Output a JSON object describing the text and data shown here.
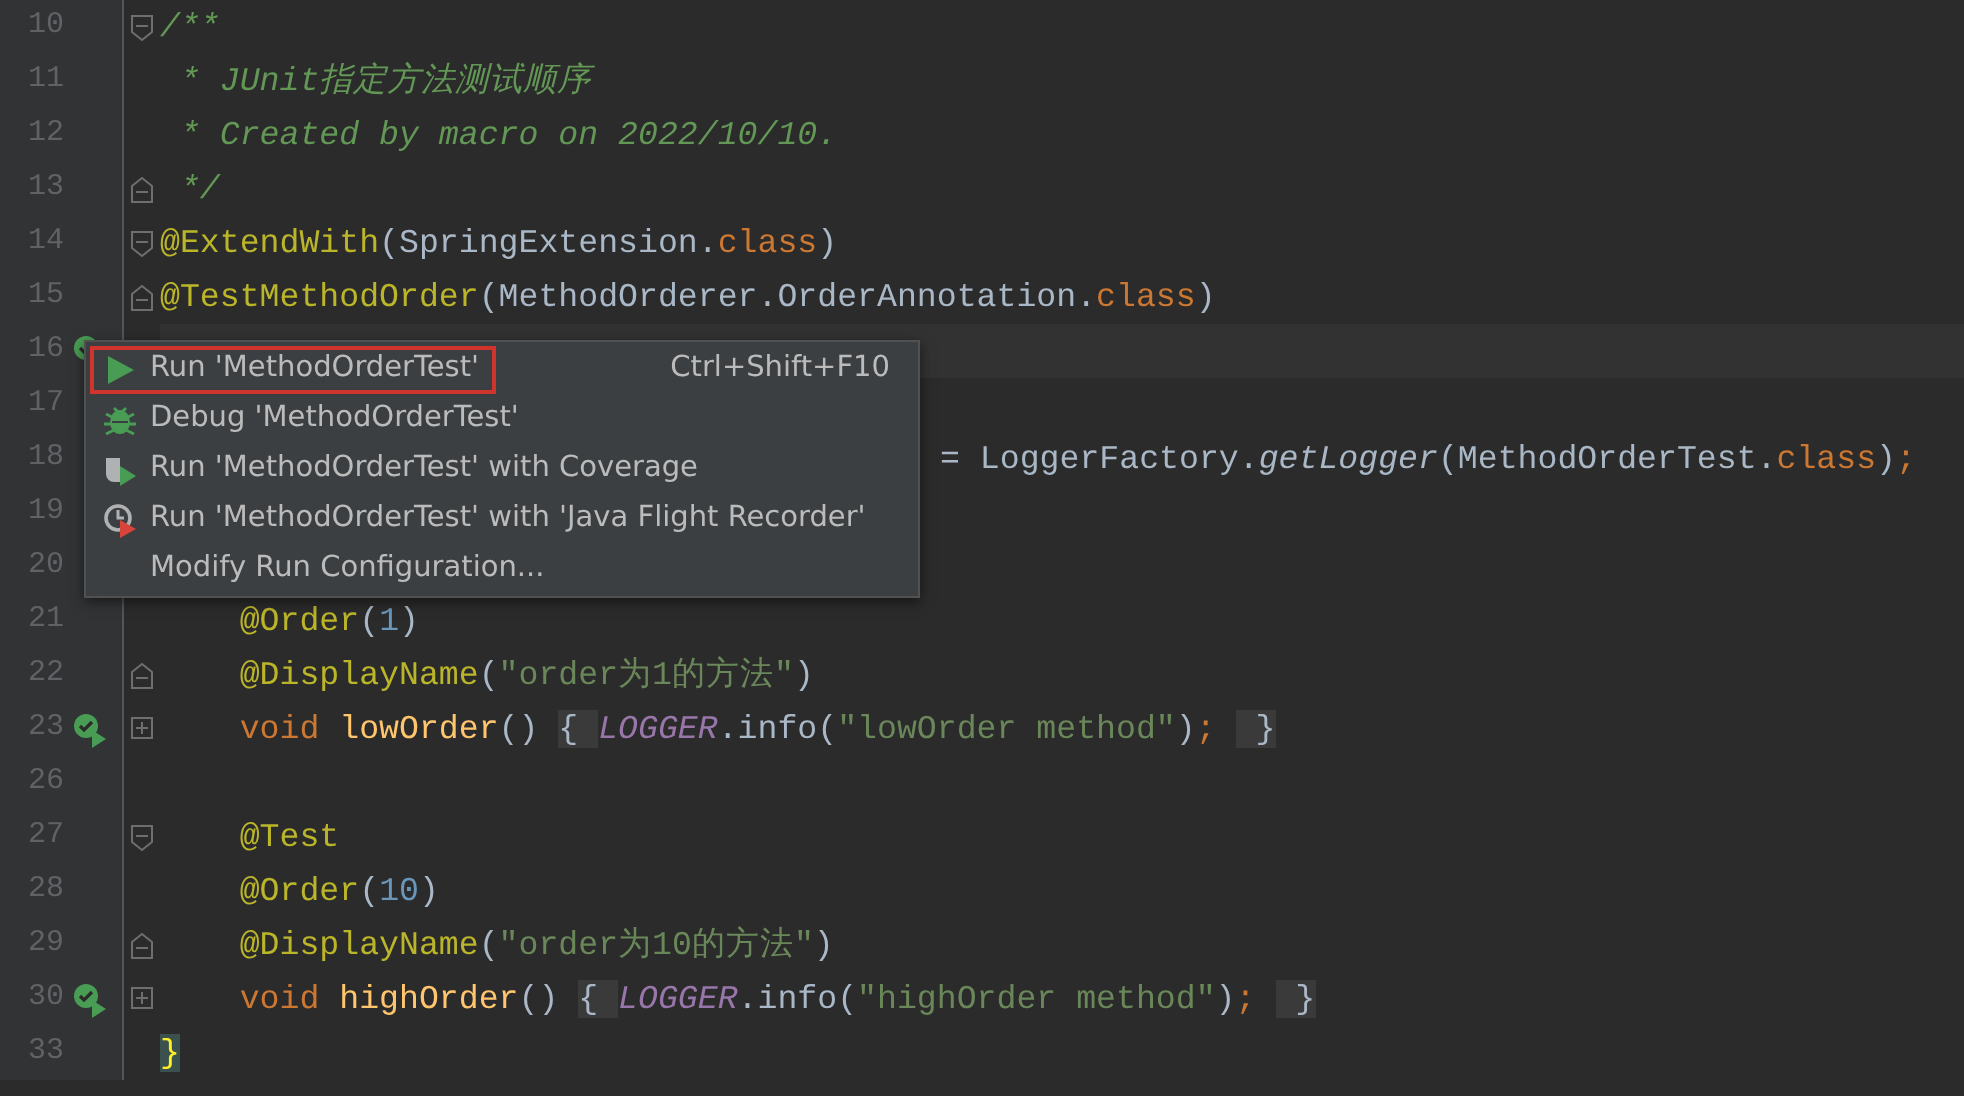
{
  "editor": {
    "lines": [
      {
        "number": "10",
        "fold_start": true,
        "tokens": [
          {
            "kind": "comment",
            "text": "/**"
          }
        ]
      },
      {
        "number": "11",
        "tokens": [
          {
            "kind": "comment",
            "text": " * JUnit指定方法测试顺序"
          }
        ]
      },
      {
        "number": "12",
        "tokens": [
          {
            "kind": "comment",
            "text": " * Created by macro on 2022/10/10."
          }
        ]
      },
      {
        "number": "13",
        "fold_end": true,
        "tokens": [
          {
            "kind": "comment",
            "text": " */"
          }
        ]
      },
      {
        "number": "14",
        "fold_start": true,
        "tokens": [
          {
            "kind": "annotation",
            "text": "@ExtendWith"
          },
          {
            "kind": "plain",
            "text": "(SpringExtension."
          },
          {
            "kind": "keyword",
            "text": "class"
          },
          {
            "kind": "plain",
            "text": ")"
          }
        ]
      },
      {
        "number": "15",
        "fold_end": true,
        "tokens": [
          {
            "kind": "annotation",
            "text": "@TestMethodOrder"
          },
          {
            "kind": "plain",
            "text": "(MethodOrderer.OrderAnnotation."
          },
          {
            "kind": "keyword",
            "text": "class"
          },
          {
            "kind": "plain",
            "text": ")"
          }
        ]
      },
      {
        "number": "16",
        "runnable": true,
        "current": true
      },
      {
        "number": "17"
      },
      {
        "number": "18",
        "starts_under_popup": true,
        "tokens": [
          {
            "kind": "plain",
            "text": "= LoggerFactory."
          },
          {
            "kind": "call",
            "text": "getLogger"
          },
          {
            "kind": "plain",
            "text": "(MethodOrderTest."
          },
          {
            "kind": "keyword",
            "text": "class"
          },
          {
            "kind": "plain",
            "text": ")"
          },
          {
            "kind": "keyword",
            "text": ";"
          }
        ]
      },
      {
        "number": "19"
      },
      {
        "number": "20"
      },
      {
        "number": "21",
        "tokens": [
          {
            "kind": "annotation",
            "text": "    @Order"
          },
          {
            "kind": "plain",
            "text": "("
          },
          {
            "kind": "number",
            "text": "1"
          },
          {
            "kind": "plain",
            "text": ")"
          }
        ]
      },
      {
        "number": "22",
        "fold_end": true,
        "tokens": [
          {
            "kind": "annotation",
            "text": "    @DisplayName"
          },
          {
            "kind": "plain",
            "text": "("
          },
          {
            "kind": "string",
            "text": "\"order为1的方法\""
          },
          {
            "kind": "plain",
            "text": ")"
          }
        ]
      },
      {
        "number": "23",
        "runnable": true,
        "collapsed": true,
        "tokens": [
          {
            "kind": "keyword",
            "text": "    void "
          },
          {
            "kind": "method",
            "text": "lowOrder"
          },
          {
            "kind": "plain",
            "text": "() "
          },
          {
            "kind": "folded",
            "text": "{ "
          },
          {
            "kind": "field",
            "text": "LOGGER"
          },
          {
            "kind": "plain",
            "text": ".info("
          },
          {
            "kind": "string",
            "text": "\"lowOrder method\""
          },
          {
            "kind": "plain",
            "text": ")"
          },
          {
            "kind": "keyword",
            "text": "; "
          },
          {
            "kind": "folded",
            "text": " }"
          }
        ]
      },
      {
        "number": "26"
      },
      {
        "number": "27",
        "fold_start": true,
        "tokens": [
          {
            "kind": "annotation",
            "text": "    @Test"
          }
        ]
      },
      {
        "number": "28",
        "tokens": [
          {
            "kind": "annotation",
            "text": "    @Order"
          },
          {
            "kind": "plain",
            "text": "("
          },
          {
            "kind": "number",
            "text": "10"
          },
          {
            "kind": "plain",
            "text": ")"
          }
        ]
      },
      {
        "number": "29",
        "fold_end": true,
        "tokens": [
          {
            "kind": "annotation",
            "text": "    @DisplayName"
          },
          {
            "kind": "plain",
            "text": "("
          },
          {
            "kind": "string",
            "text": "\"order为10的方法\""
          },
          {
            "kind": "plain",
            "text": ")"
          }
        ]
      },
      {
        "number": "30",
        "runnable": true,
        "collapsed": true,
        "tokens": [
          {
            "kind": "keyword",
            "text": "    void "
          },
          {
            "kind": "method",
            "text": "highOrder"
          },
          {
            "kind": "plain",
            "text": "() "
          },
          {
            "kind": "folded",
            "text": "{ "
          },
          {
            "kind": "field",
            "text": "LOGGER"
          },
          {
            "kind": "plain",
            "text": ".info("
          },
          {
            "kind": "string",
            "text": "\"highOrder method\""
          },
          {
            "kind": "plain",
            "text": ")"
          },
          {
            "kind": "keyword",
            "text": "; "
          },
          {
            "kind": "folded",
            "text": " }"
          }
        ]
      },
      {
        "number": "33",
        "tokens": [
          {
            "kind": "match",
            "text": "}"
          }
        ]
      }
    ]
  },
  "run_menu": {
    "items": [
      {
        "kind": "run",
        "label": "Run 'MethodOrderTest'",
        "shortcut": "Ctrl+Shift+F10",
        "selected": true
      },
      {
        "kind": "debug",
        "label": "Debug 'MethodOrderTest'",
        "selected": false
      },
      {
        "kind": "coverage",
        "label": "Run 'MethodOrderTest' with Coverage",
        "selected": false
      },
      {
        "kind": "profiler",
        "label": "Run 'MethodOrderTest' with 'Java Flight Recorder'",
        "selected": false
      },
      {
        "kind": "plain",
        "label": "Modify Run Configuration...",
        "selected": false
      }
    ]
  }
}
